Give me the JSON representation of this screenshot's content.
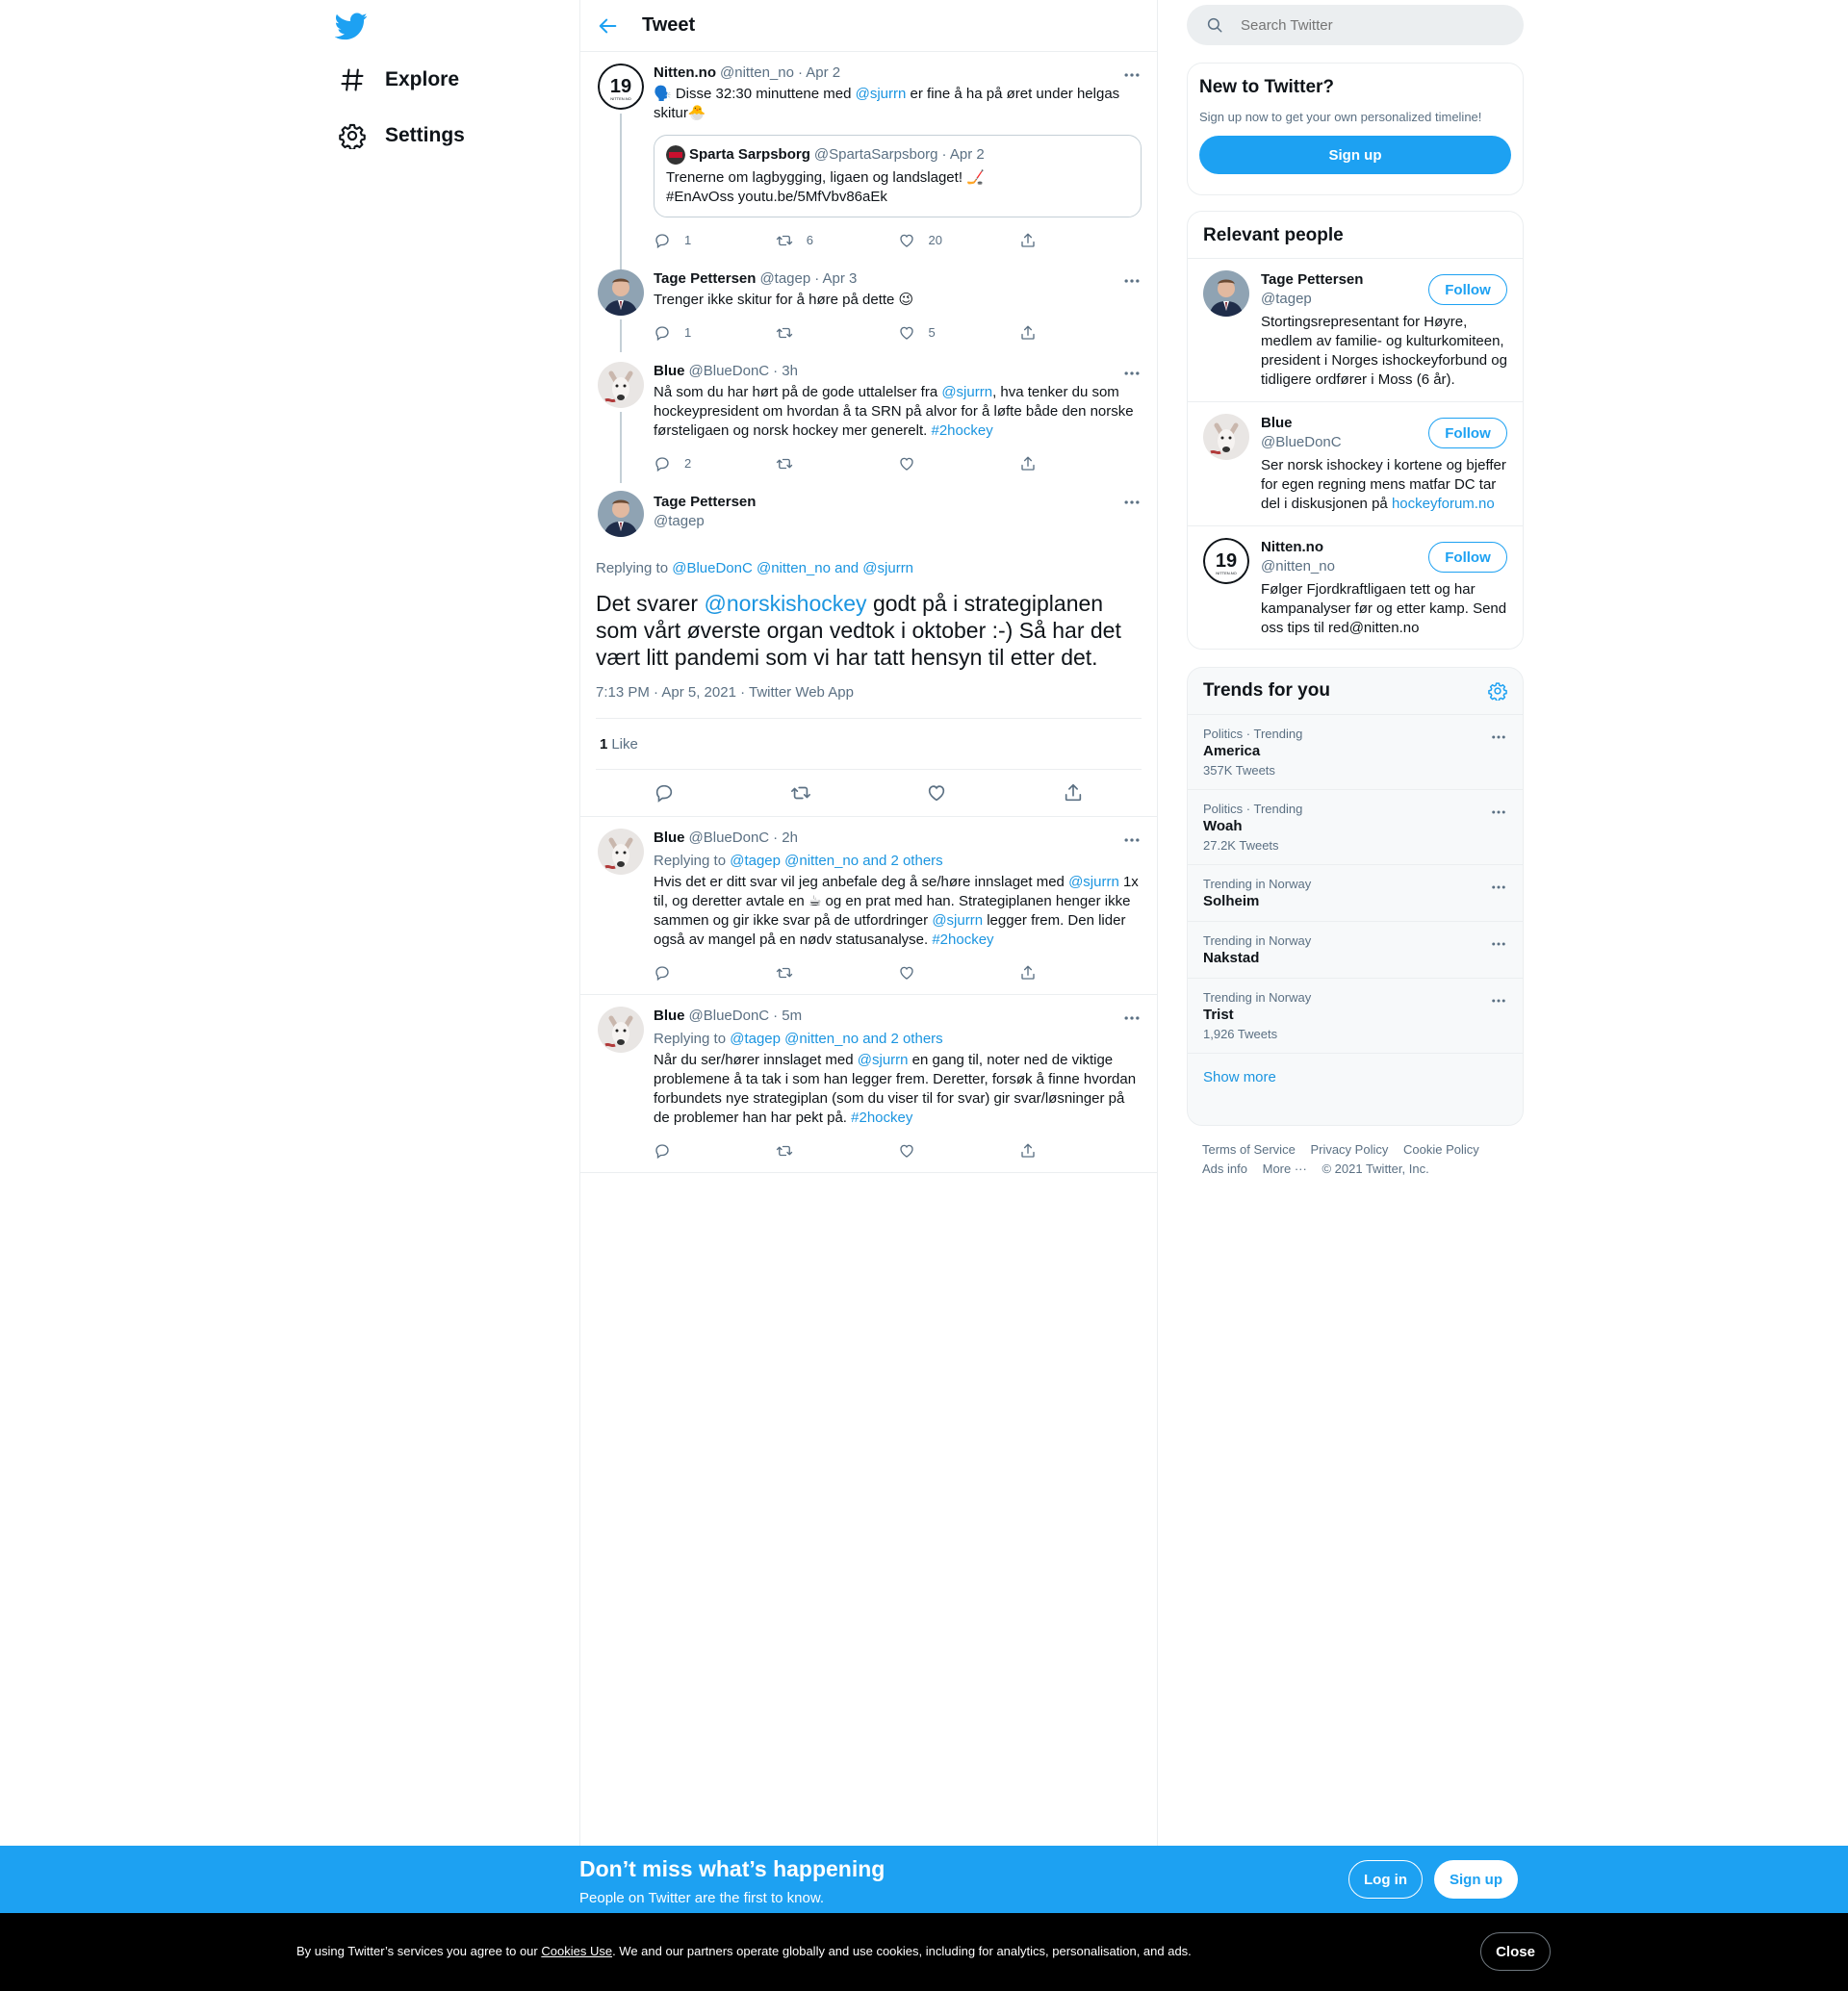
{
  "nav": {
    "items": [
      {
        "label": "Explore",
        "icon": "hashtag-icon"
      },
      {
        "label": "Settings",
        "icon": "gear-icon"
      }
    ]
  },
  "header": {
    "title": "Tweet"
  },
  "thread": [
    {
      "name": "Nitten.no",
      "handle": "@nitten_no",
      "time": "· Apr 2",
      "text_a": "🗣️ Disse 32:30 minuttene med ",
      "mention": "@sjurrn",
      "text_b": " er fine å ha på øret under helgas skitur🐣",
      "quote": {
        "name": "Sparta Sarpsborg",
        "handle": "@SpartaSarpsborg",
        "time": "· Apr 2",
        "text": "Trenerne om lagbygging, ligaen og landslaget! 🏒 #EnAvOss youtu.be/5MfVbv86aEk"
      },
      "replies": "1",
      "retweets": "6",
      "likes": "20"
    },
    {
      "name": "Tage Pettersen",
      "handle": "@tagep",
      "time": "· Apr 3",
      "text": "Trenger ikke skitur for å høre på dette 😉",
      "replies": "1",
      "retweets": "",
      "likes": "5"
    },
    {
      "name": "Blue",
      "handle": "@BlueDonC",
      "time": "· 3h",
      "text_a": "Nå som du har hørt på de gode uttalelser fra ",
      "mention": "@sjurrn",
      "text_b": ", hva tenker du som hockeypresident om hvordan å ta SRN på alvor for å løfte både den norske førsteligaen og norsk hockey mer generelt. ",
      "hashtag": "#2hockey",
      "replies": "2",
      "retweets": "",
      "likes": ""
    }
  ],
  "focused": {
    "name": "Tage Pettersen",
    "handle": "@tagep",
    "replying_prefix": "Replying to ",
    "replying_to": "@BlueDonC @nitten_no and @sjurrn",
    "text_a": "Det svarer ",
    "mention": "@norskishockey",
    "text_b": " godt på i strategiplanen som vårt øverste organ vedtok i oktober :-) Så har det vært litt pandemi som vi har tatt hensyn til etter det.",
    "meta": "7:13 PM · Apr 5, 2021 · Twitter Web App",
    "like_count": "1",
    "like_label": "Like"
  },
  "replies": [
    {
      "name": "Blue",
      "handle": "@BlueDonC",
      "time": "· 2h",
      "replying_prefix": "Replying to ",
      "replying_to": "@tagep @nitten_no and 2 others",
      "text_a": "Hvis det er ditt svar vil jeg anbefale deg å se/høre innslaget med ",
      "mention1": "@sjurrn",
      "text_b": " 1x til, og deretter avtale en ☕ og en prat med han. Strategiplanen henger ikke sammen og gir ikke svar på de utfordringer ",
      "mention2": "@sjurrn",
      "text_c": " legger frem. Den lider også av mangel på en nødv statusanalyse. ",
      "hashtag": "#2hockey"
    },
    {
      "name": "Blue",
      "handle": "@BlueDonC",
      "time": "· 5m",
      "replying_prefix": "Replying to ",
      "replying_to": "@tagep @nitten_no and 2 others",
      "text_a": "Når du ser/hører innslaget med ",
      "mention1": "@sjurrn",
      "text_b": " en gang til, noter ned de viktige problemene å ta tak i som han legger frem. Deretter, forsøk å finne hvordan forbundets nye strategiplan (som du viser til for svar) gir svar/løsninger på de problemer han har pekt på. ",
      "hashtag": "#2hockey"
    }
  ],
  "search": {
    "placeholder": "Search Twitter"
  },
  "new_to": {
    "title": "New to Twitter?",
    "subtitle": "Sign up now to get your own personalized timeline!",
    "button": "Sign up"
  },
  "relevant": {
    "title": "Relevant people",
    "people": [
      {
        "name": "Tage Pettersen",
        "handle": "@tagep",
        "bio": "Stortingsrepresentant for Høyre, medlem av familie- og kulturkomiteen, president i Norges ishockeyforbund og tidligere ordfører i Moss (6 år).",
        "button": "Follow"
      },
      {
        "name": "Blue",
        "handle": "@BlueDonC",
        "bio": "Ser norsk ishockey i kortene og bjeffer for egen regning mens matfar DC tar del i diskusjonen på ",
        "link": "hockeyforum.no",
        "button": "Follow"
      },
      {
        "name": "Nitten.no",
        "handle": "@nitten_no",
        "bio": "Følger Fjordkraftligaen tett og har kampanalyser før og etter kamp. Send oss tips til red@nitten.no",
        "button": "Follow"
      }
    ]
  },
  "trends": {
    "title": "Trends for you",
    "items": [
      {
        "context": "Politics · Trending",
        "topic": "America",
        "count": "357K Tweets"
      },
      {
        "context": "Politics · Trending",
        "topic": "Woah",
        "count": "27.2K Tweets"
      },
      {
        "context": "Trending in Norway",
        "topic": "Solheim",
        "count": ""
      },
      {
        "context": "Trending in Norway",
        "topic": "Nakstad",
        "count": ""
      },
      {
        "context": "Trending in Norway",
        "topic": "Trist",
        "count": "1,926 Tweets"
      }
    ],
    "show_more": "Show more"
  },
  "footer": {
    "links": [
      "Terms of Service",
      "Privacy Policy",
      "Cookie Policy",
      "Ads info",
      "More ···"
    ],
    "copyright": "© 2021 Twitter, Inc."
  },
  "signup_bar": {
    "title": "Don’t miss what’s happening",
    "subtitle": "People on Twitter are the first to know.",
    "login": "Log in",
    "signup": "Sign up"
  },
  "cookie_bar": {
    "text_a": "By using Twitter’s services you agree to our ",
    "link": "Cookies Use",
    "text_b": ". We and our partners operate globally and use cookies, including for analytics, personalisation, and ads.",
    "close": "Close"
  },
  "colors": {
    "accent": "#1da1f2",
    "link": "#1b95e0",
    "muted": "#5b7083",
    "border": "#ebeef0"
  }
}
